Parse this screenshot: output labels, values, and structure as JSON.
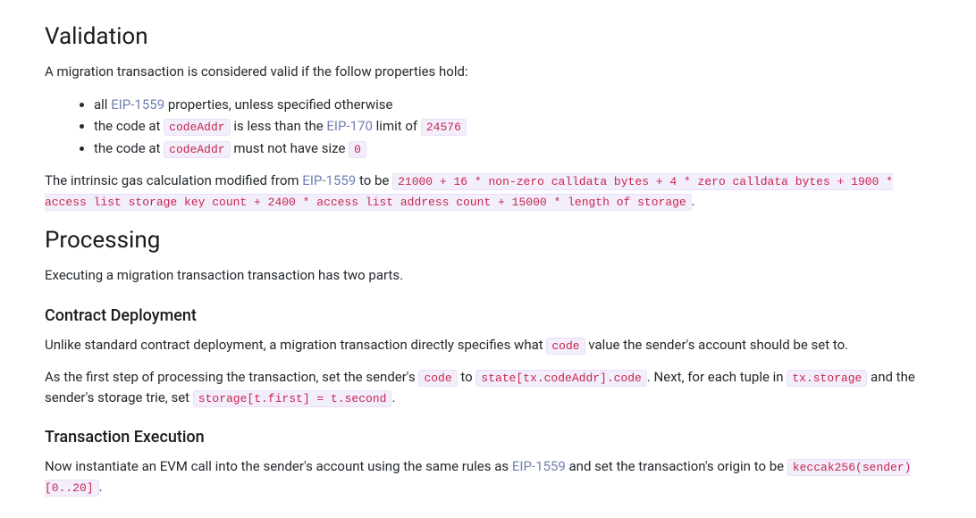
{
  "validation": {
    "heading": "Validation",
    "intro": "A migration transaction is considered valid if the follow properties hold:",
    "bullets": {
      "b1_prefix": "all ",
      "b1_link": "EIP-1559",
      "b1_suffix": " properties, unless specified otherwise",
      "b2_prefix": "the code at ",
      "b2_code1": "codeAddr",
      "b2_mid": " is less than the ",
      "b2_link": "EIP-170",
      "b2_mid2": " limit of ",
      "b2_code2": "24576",
      "b3_prefix": "the code at ",
      "b3_code1": "codeAddr",
      "b3_mid": " must not have size ",
      "b3_code2": "0"
    },
    "gas": {
      "prefix": "The intrinsic gas calculation modified from ",
      "link": "EIP-1559",
      "mid": " to be ",
      "code": "21000 + 16 * non-zero calldata bytes + 4 * zero calldata bytes + 1900 * access list storage key count + 2400 * access list address count + 15000 * length of storage",
      "suffix": "."
    }
  },
  "processing": {
    "heading": "Processing",
    "intro": "Executing a migration transaction transaction has two parts."
  },
  "contract_deployment": {
    "heading": "Contract Deployment",
    "p1_prefix": "Unlike standard contract deployment, a migration transaction directly specifies what ",
    "p1_code": "code",
    "p1_suffix": " value the sender's account should be set to.",
    "p2_prefix": "As the first step of processing the transaction, set the sender's ",
    "p2_code1": "code",
    "p2_mid1": " to ",
    "p2_code2": "state[tx.codeAddr].code",
    "p2_mid2": ". Next, for each tuple in ",
    "p2_code3": "tx.storage",
    "p2_mid3": " and the sender's storage trie, set ",
    "p2_code4": "storage[t.first] = t.second",
    "p2_suffix": "."
  },
  "transaction_execution": {
    "heading": "Transaction Execution",
    "p1_prefix": "Now instantiate an EVM call into the sender's account using the same rules as ",
    "p1_link": "EIP-1559",
    "p1_mid": " and set the transaction's origin to be ",
    "p1_code": "keccak256(sender)[0..20]",
    "p1_suffix": "."
  }
}
